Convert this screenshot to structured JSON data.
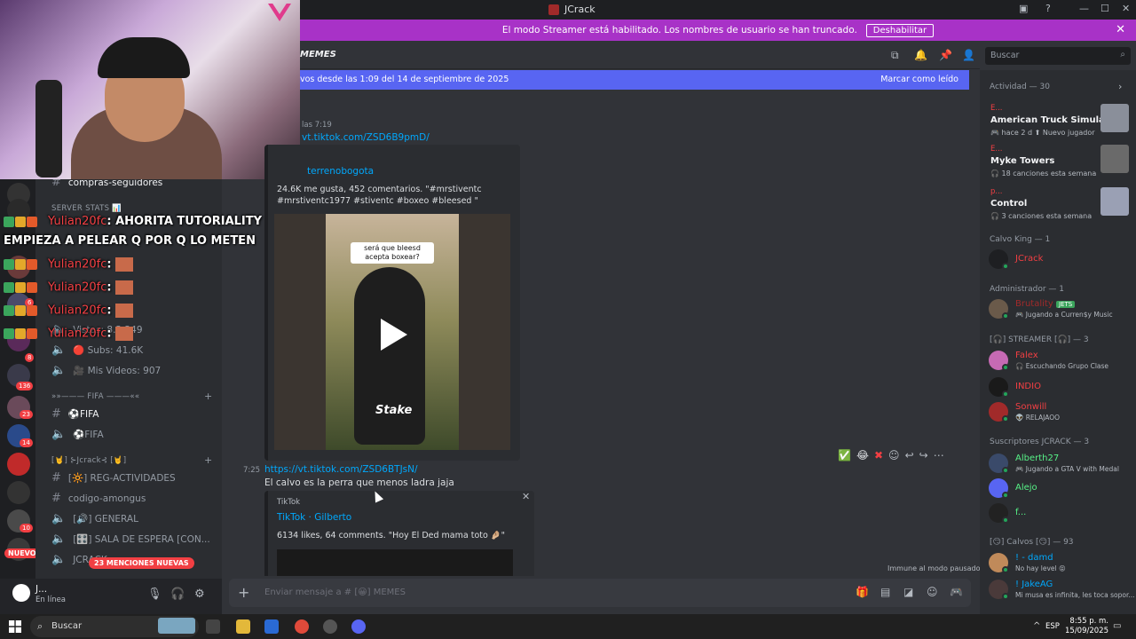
{
  "window": {
    "title": "JCrack",
    "controls": [
      "—",
      "☐",
      "✕"
    ]
  },
  "banner": {
    "text": "El modo Streamer está habilitado. Los nombres de usuario se han truncado.",
    "disable_label": "Deshabilitar"
  },
  "channel_header": {
    "name": "MEMES",
    "search_placeholder": "Buscar"
  },
  "new_messages_bar": {
    "text": "vos desde las 1:09 del 14 de septiembre de 2025",
    "mark_read": "Marcar como leído"
  },
  "overlay_chat": [
    {
      "user": "Yulian20fc",
      "text": ": AHORITA TUTORIALITY"
    },
    {
      "user": "",
      "text": "EMPIEZA A PELEAR Q POR Q LO METEN"
    },
    {
      "user": "Yulian20fc",
      "text": ":"
    },
    {
      "user": "Yulian20fc",
      "text": ":"
    },
    {
      "user": "Yulian20fc",
      "text": ":"
    },
    {
      "user": "Yulian20fc",
      "text": ":"
    }
  ],
  "sidebar": {
    "channels": [
      {
        "name": "compras-seguidores",
        "type": "text"
      },
      {
        "name": "SERVER STATS 📊",
        "type": "category"
      },
      {
        "name": "Vistas: 8.2,249",
        "type": "voice"
      },
      {
        "name": "🔴 Subs: 41.6K",
        "type": "voice"
      },
      {
        "name": "🎥 Mis Videos: 907",
        "type": "voice"
      },
      {
        "name": "»»——— FIFA ———««",
        "type": "category"
      },
      {
        "name": "⚽FIFA",
        "type": "text",
        "bold": true
      },
      {
        "name": "⚽FIFA",
        "type": "voice"
      },
      {
        "name": "[🤘] ⊱Jcrack⊰ [🤘]",
        "type": "category"
      },
      {
        "name": "[🔆] REG-ACTIVIDADES",
        "type": "text"
      },
      {
        "name": "codigo-amongus",
        "type": "text"
      },
      {
        "name": "[🔊] GENERAL",
        "type": "voice"
      },
      {
        "name": "[🎛️] SALA DE ESPERA [CON...",
        "type": "voice"
      },
      {
        "name": "JCRACK",
        "type": "voice"
      }
    ],
    "mentions_badge": "23 MENCIONES NUEVAS",
    "nuevo_badge": "NUEVO",
    "server_badges": [
      "6",
      "8",
      "136",
      "23",
      "14",
      "10"
    ]
  },
  "user_panel": {
    "name": "J...",
    "status": "En línea"
  },
  "messages": [
    {
      "time": "las 7:19",
      "link": "vt.tiktok.com/ZSD6B9pmD/",
      "embed": {
        "author": "terrenobogota",
        "description": "24.6K me gusta, 452 comentarios. \"#mrstiventc #mrstiventc1977 #stiventc #boxeo #bleesed \"",
        "video_caption": "será que bleesd acepta boxear?",
        "video_watermark": "Stake"
      }
    },
    {
      "time": "7:25",
      "link": "https://vt.tiktok.com/ZSD6BTJsN/",
      "text": "El calvo es la perra que menos ladra jaja",
      "embed": {
        "provider": "TikTok",
        "author": "TikTok · Gilberto",
        "description": "6134 likes, 64 comments. \"Hoy El Ded mama toto 🤌🏼\""
      }
    }
  ],
  "immune_text": "Immune al modo pausado",
  "composer": {
    "placeholder": "Enviar mensaje a # [😀] MEMES"
  },
  "members": {
    "activity_header": "Actividad — 30",
    "activities": [
      {
        "game_prefix": "E...",
        "title": "American Truck Simulator",
        "sub": "🎮 hace 2 d  ⬆ Nuevo jugador"
      },
      {
        "game_prefix": "E...",
        "title": "Myke Towers",
        "sub": "🎧 18 canciones esta semana"
      },
      {
        "game_prefix": "p...",
        "title": "Control",
        "sub": "🎧 3 canciones esta semana"
      }
    ],
    "groups": [
      {
        "header": "Calvo King — 1",
        "members": [
          {
            "name": "JCrack",
            "color": "#f23f43",
            "sub": ""
          }
        ]
      },
      {
        "header": "Administrador — 1",
        "members": [
          {
            "name": "Brutality",
            "color": "#a12a2a",
            "tag": "JETS",
            "sub": "🎮 Jugando a Curren$y Music"
          }
        ]
      },
      {
        "header": "[🎧] STREAMER [🎧] — 3",
        "members": [
          {
            "name": "Falex",
            "color": "#f23f43",
            "sub": "🎧 Escuchando Grupo Clase"
          },
          {
            "name": "INDIO",
            "color": "#f23f43",
            "sub": ""
          },
          {
            "name": "Sonwill",
            "color": "#f23f43",
            "sub": "👽 RELAJAOO"
          }
        ]
      },
      {
        "header": "Suscriptores JCRACK — 3",
        "members": [
          {
            "name": "Alberth27",
            "color": "#57f287",
            "sub": "🎮 Jugando a GTA V with Medal"
          },
          {
            "name": "Alejo",
            "color": "#57f287",
            "sub": ""
          },
          {
            "name": "f...",
            "color": "#57f287",
            "sub": ""
          }
        ]
      },
      {
        "header": "[😏] Calvos [😏] — 93",
        "members": [
          {
            "name": "! - damd",
            "color": "#00a8fc",
            "sub": "No hay level 😝"
          },
          {
            "name": "! JakeAG",
            "color": "#00a8fc",
            "sub": "Mi musa es infinita, les toca sopor..."
          }
        ]
      }
    ]
  },
  "taskbar": {
    "search": "Buscar",
    "lang": "ESP",
    "time": "8:55 p. m.",
    "date": "15/09/2025"
  },
  "colors": {
    "blurple": "#5865f2",
    "banner": "#a832c7",
    "danger": "#f23f43",
    "link": "#00a8fc"
  }
}
